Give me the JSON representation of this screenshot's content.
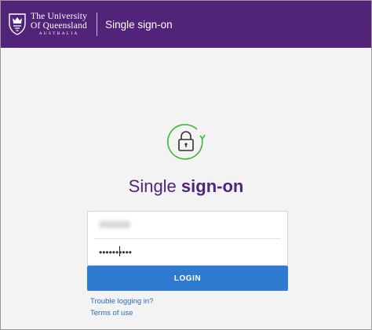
{
  "header": {
    "logo": {
      "line1": "The University",
      "line2": "Of Queensland",
      "line3": "AUSTRALIA"
    },
    "title": "Single sign-on"
  },
  "icon": {
    "name": "lock-icon",
    "accent": "#3db83d"
  },
  "main": {
    "title_light": "Single ",
    "title_bold": "sign-on"
  },
  "form": {
    "username_value": "",
    "password_value": "••••••••••"
  },
  "login_button": {
    "label": "LOGIN"
  },
  "links": {
    "trouble": "Trouble logging in?",
    "terms": "Terms of use"
  },
  "colors": {
    "brand_purple": "#51247a",
    "button_blue": "#2f7ad1",
    "link_blue": "#2a6db8"
  }
}
